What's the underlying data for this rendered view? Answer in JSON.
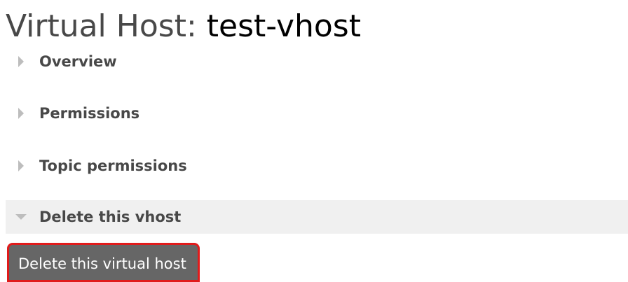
{
  "title": {
    "prefix": "Virtual Host:",
    "name": "test-vhost"
  },
  "sections": [
    {
      "label": "Overview",
      "state": "collapsed"
    },
    {
      "label": "Permissions",
      "state": "collapsed"
    },
    {
      "label": "Topic permissions",
      "state": "collapsed"
    },
    {
      "label": "Delete this vhost",
      "state": "expanded"
    }
  ],
  "delete_section": {
    "button_label": "Delete this virtual host"
  },
  "colors": {
    "title_text": "#484848",
    "title_name": "#000000",
    "section_label": "#484848",
    "arrow": "#bdbdbd",
    "expanded_section_bg": "#f0f0f0",
    "button_bg": "#666666",
    "button_border_highlight": "#e01b1b",
    "button_text": "#ffffff"
  },
  "icons": [
    "triangle-right-icon",
    "triangle-down-icon"
  ]
}
